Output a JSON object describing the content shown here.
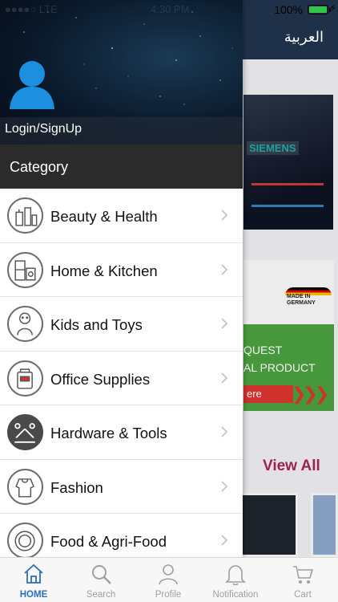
{
  "status_bar": {
    "carrier": "●●●●○ LTE",
    "time": "4:30 PM",
    "battery_percent": "100%",
    "battery_level": 1.0
  },
  "header": {
    "language_link": "العربية"
  },
  "background": {
    "banner1_brand": "SIEMENS",
    "banner2_badge": "MADE IN GERMANY",
    "banner2_line1": "QUEST",
    "banner2_line2": "AL PRODUCT",
    "banner2_cta": "ere",
    "view_all": "View All"
  },
  "drawer": {
    "login_link": "Login/SignUp",
    "category_title": "Category",
    "categories": [
      {
        "label": "Beauty & Health",
        "icon": "beauty-health-icon"
      },
      {
        "label": "Home & Kitchen",
        "icon": "home-kitchen-icon"
      },
      {
        "label": "Kids and Toys",
        "icon": "kids-toys-icon"
      },
      {
        "label": "Office Supplies",
        "icon": "office-supplies-icon"
      },
      {
        "label": "Hardware & Tools",
        "icon": "hardware-tools-icon"
      },
      {
        "label": "Fashion",
        "icon": "fashion-icon"
      },
      {
        "label": "Food & Agri-Food",
        "icon": "food-icon"
      }
    ]
  },
  "tabbar": {
    "tabs": [
      {
        "label": "HOME",
        "icon": "home-icon",
        "active": true
      },
      {
        "label": "Search",
        "icon": "search-icon",
        "active": false
      },
      {
        "label": "Profile",
        "icon": "profile-icon",
        "active": false
      },
      {
        "label": "Notification",
        "icon": "bell-icon",
        "active": false
      },
      {
        "label": "Cart",
        "icon": "cart-icon",
        "active": false
      }
    ]
  },
  "colors": {
    "header": "#1f3148",
    "accent": "#2c6fb6",
    "view_all": "#a32552",
    "category_bar": "#2b2b2b"
  }
}
